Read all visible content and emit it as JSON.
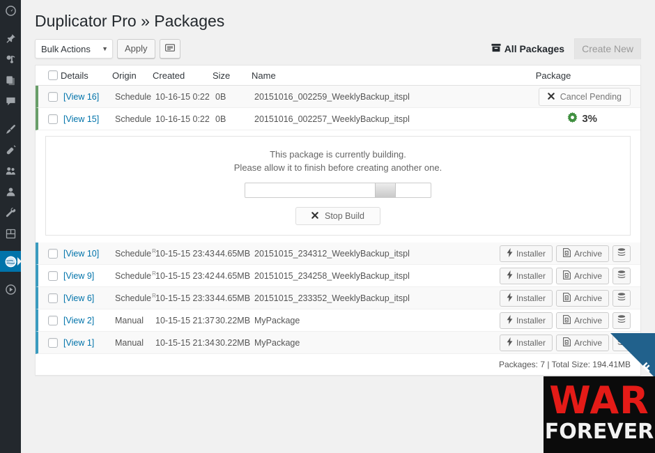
{
  "sidebar": {
    "items": [
      {
        "name": "dashboard",
        "icon": "dashboard-icon",
        "current": false
      },
      {
        "name": "posts",
        "icon": "pin-icon",
        "current": false
      },
      {
        "name": "media",
        "icon": "media-icon",
        "current": false
      },
      {
        "name": "pages",
        "icon": "pages-icon",
        "current": false
      },
      {
        "name": "comments",
        "icon": "comment-icon",
        "current": false
      },
      {
        "name": "appearance",
        "icon": "paintbrush-icon",
        "current": false
      },
      {
        "name": "plugins",
        "icon": "plug-icon",
        "current": false
      },
      {
        "name": "users",
        "icon": "users-icon",
        "current": false
      },
      {
        "name": "profile",
        "icon": "person-icon",
        "current": false
      },
      {
        "name": "tools",
        "icon": "wrench-icon",
        "current": false
      },
      {
        "name": "settings",
        "icon": "settings-icon",
        "current": false
      },
      {
        "name": "duplicator-pro",
        "icon": "globe-icon",
        "current": true
      },
      {
        "name": "collapse-menu",
        "icon": "collapse-icon",
        "current": false
      }
    ]
  },
  "header": {
    "title": "Duplicator Pro » Packages"
  },
  "toolbar": {
    "bulk_actions_label": "Bulk Actions",
    "bulk_actions_caret": "▼",
    "apply_label": "Apply",
    "list_view_icon": "list-view-icon"
  },
  "tabs": [
    {
      "label": "All Packages",
      "icon": "archive-box-icon",
      "active": true
    },
    {
      "label": "Create New",
      "icon": "",
      "active": false
    }
  ],
  "table": {
    "columns": {
      "details": "Details",
      "origin": "Origin",
      "created": "Created",
      "size": "Size",
      "name": "Name",
      "package": "Package"
    },
    "pending_rows": [
      {
        "details": "[View 16]",
        "origin": "Schedule",
        "origin_sup": "",
        "created": "10-16-15 0:22",
        "size": "0B",
        "name": "20151016_002259_WeeklyBackup_itspl",
        "action_type": "cancel",
        "cancel_label": "Cancel Pending",
        "cancel_icon": "x-icon"
      },
      {
        "details": "[View 15]",
        "origin": "Schedule",
        "origin_sup": "",
        "created": "10-16-15 0:22",
        "size": "0B",
        "name": "20151016_002257_WeeklyBackup_itspl",
        "action_type": "progress",
        "progress_label": "3%",
        "progress_icon": "gear-icon"
      }
    ],
    "build_panel": {
      "line1": "This package is currently building.",
      "line2": "Please allow it to finish before creating another one.",
      "progress_position_pct": 70,
      "stop_label": "Stop Build",
      "stop_icon": "x-icon"
    },
    "done_rows": [
      {
        "details": "[View 10]",
        "origin": "Schedule",
        "origin_sup": "R",
        "created": "10-15-15 23:43",
        "size": "44.65MB",
        "name": "20151015_234312_WeeklyBackup_itspl"
      },
      {
        "details": "[View 9]",
        "origin": "Schedule",
        "origin_sup": "R",
        "created": "10-15-15 23:42",
        "size": "44.65MB",
        "name": "20151015_234258_WeeklyBackup_itspl"
      },
      {
        "details": "[View 6]",
        "origin": "Schedule",
        "origin_sup": "R",
        "created": "10-15-15 23:33",
        "size": "44.65MB",
        "name": "20151015_233352_WeeklyBackup_itspl"
      },
      {
        "details": "[View 2]",
        "origin": "Manual",
        "origin_sup": "",
        "created": "10-15-15 21:37",
        "size": "30.22MB",
        "name": "MyPackage"
      },
      {
        "details": "[View 1]",
        "origin": "Manual",
        "origin_sup": "",
        "created": "10-15-15 21:34",
        "size": "30.22MB",
        "name": "MyPackage"
      }
    ],
    "row_actions": {
      "installer_label": "Installer",
      "installer_icon": "bolt-icon",
      "archive_label": "Archive",
      "archive_icon": "file-zip-icon",
      "database_icon": "database-icon"
    },
    "footer": "Packages: 7 | Total Size: 194.41MB"
  },
  "watermark": {
    "line1": "WAR",
    "line2": "FOREVER",
    "ribbon_text": "F"
  },
  "colors": {
    "accent_blue": "#0073aa",
    "pending_border": "#689e68",
    "done_border": "#3a9bbf",
    "gear_green": "#3f8f3f",
    "watermark_red": "#e41b17"
  }
}
